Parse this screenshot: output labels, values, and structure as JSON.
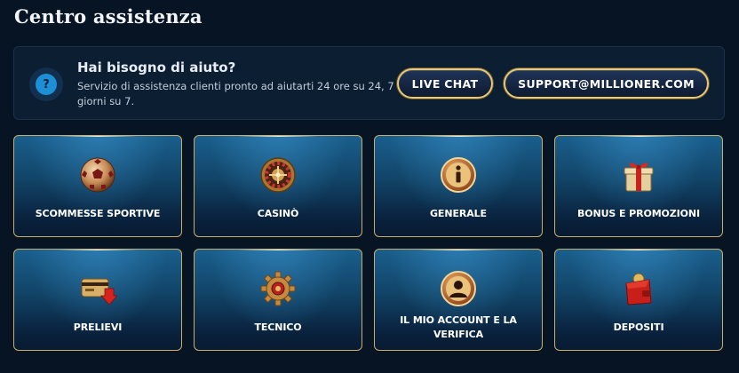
{
  "page": {
    "title": "Centro assistenza"
  },
  "help": {
    "icon": "question-icon",
    "title": "Hai bisogno di aiuto?",
    "text": "Servizio di assistenza clienti pronto ad aiutarti 24 ore su 24, 7 giorni su 7.",
    "live_chat_label": "LIVE CHAT",
    "email_label": "SUPPORT@MILLIONER.COM"
  },
  "categories": [
    {
      "label": "SCOMMESSE SPORTIVE",
      "icon": "soccer-ball-icon"
    },
    {
      "label": "CASINÒ",
      "icon": "roulette-icon"
    },
    {
      "label": "GENERALE",
      "icon": "info-icon"
    },
    {
      "label": "BONUS E PROMOZIONI",
      "icon": "gift-icon"
    },
    {
      "label": "PRELIEVI",
      "icon": "card-withdraw-icon"
    },
    {
      "label": "TECNICO",
      "icon": "gear-icon"
    },
    {
      "label": "IL MIO ACCOUNT E LA VERIFICA",
      "icon": "user-account-icon"
    },
    {
      "label": "DEPOSITI",
      "icon": "wallet-icon"
    }
  ],
  "colors": {
    "background": "#071424",
    "banner": "#0b1e32",
    "gold_border": "#c9ad6a",
    "button_border": "#e8c977",
    "help_icon": "#1c8fd6"
  }
}
